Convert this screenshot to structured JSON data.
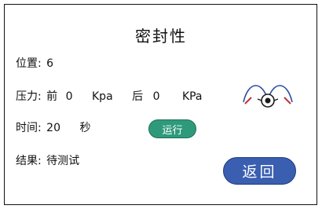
{
  "page": {
    "title": "密封性"
  },
  "position": {
    "label": "位置:",
    "value": "6"
  },
  "pressure": {
    "label": "压力:",
    "front_label": "前",
    "front_value": "0",
    "front_unit": "Kpa",
    "back_label": "后",
    "back_value": "0",
    "back_unit": "KPa"
  },
  "time": {
    "label": "时间:",
    "value": "20",
    "unit": "秒"
  },
  "result": {
    "label": "结果:",
    "value": "待测试"
  },
  "buttons": {
    "run_label": "运行",
    "back_label": "返回"
  },
  "icons": {
    "device": "sealing-device-icon"
  },
  "colors": {
    "run_button": "#2f9a7b",
    "back_button": "#3a5fb0"
  }
}
